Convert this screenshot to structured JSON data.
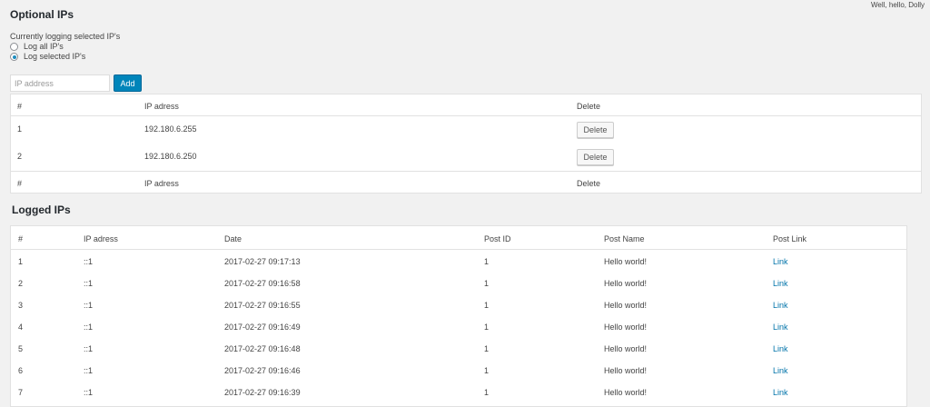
{
  "header": {
    "greeting": "Well, hello, Dolly"
  },
  "optional_ips": {
    "title": "Optional IPs",
    "status_text": "Currently logging selected IP's",
    "options": [
      {
        "label": "Log all IP's",
        "checked": false
      },
      {
        "label": "Log selected IP's",
        "checked": true
      }
    ],
    "input_placeholder": "IP address",
    "add_label": "Add",
    "columns": [
      "#",
      "IP adress",
      "Delete"
    ],
    "rows": [
      {
        "num": "1",
        "ip": "192.180.6.255",
        "action": "Delete"
      },
      {
        "num": "2",
        "ip": "192.180.6.250",
        "action": "Delete"
      }
    ]
  },
  "logged_ips": {
    "title": "Logged IPs",
    "columns": [
      "#",
      "IP adress",
      "Date",
      "Post ID",
      "Post Name",
      "Post Link"
    ],
    "rows": [
      {
        "num": "1",
        "ip": "::1",
        "date": "2017-02-27 09:17:13",
        "post_id": "1",
        "post_name": "Hello world!",
        "link": "Link"
      },
      {
        "num": "2",
        "ip": "::1",
        "date": "2017-02-27 09:16:58",
        "post_id": "1",
        "post_name": "Hello world!",
        "link": "Link"
      },
      {
        "num": "3",
        "ip": "::1",
        "date": "2017-02-27 09:16:55",
        "post_id": "1",
        "post_name": "Hello world!",
        "link": "Link"
      },
      {
        "num": "4",
        "ip": "::1",
        "date": "2017-02-27 09:16:49",
        "post_id": "1",
        "post_name": "Hello world!",
        "link": "Link"
      },
      {
        "num": "5",
        "ip": "::1",
        "date": "2017-02-27 09:16:48",
        "post_id": "1",
        "post_name": "Hello world!",
        "link": "Link"
      },
      {
        "num": "6",
        "ip": "::1",
        "date": "2017-02-27 09:16:46",
        "post_id": "1",
        "post_name": "Hello world!",
        "link": "Link"
      },
      {
        "num": "7",
        "ip": "::1",
        "date": "2017-02-27 09:16:39",
        "post_id": "1",
        "post_name": "Hello world!",
        "link": "Link"
      }
    ]
  },
  "colors": {
    "primary": "#0085ba",
    "link": "#0073aa",
    "background": "#f1f1f1"
  }
}
